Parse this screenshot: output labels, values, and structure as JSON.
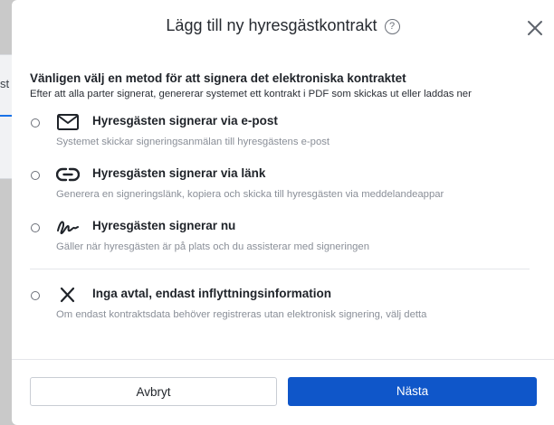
{
  "background": {
    "partial_tab_text": "st -"
  },
  "dialog": {
    "title": "Lägg till ny hyresgästkontrakt",
    "help_symbol": "?",
    "intro_title": "Vänligen välj en metod för att signera det elektroniska kontraktet",
    "intro_subtitle": "Efter att alla parter signerat, genererar systemet ett kontrakt i PDF som skickas ut eller laddas ner",
    "options": [
      {
        "icon": "envelope-icon",
        "label": "Hyresgästen signerar via e-post",
        "description": "Systemet skickar signeringsanmälan till hyresgästens e-post",
        "selected": false
      },
      {
        "icon": "link-icon",
        "label": "Hyresgästen signerar via länk",
        "description": "Generera en signeringslänk, kopiera och skicka till hyresgästen via meddelandeappar",
        "selected": false
      },
      {
        "icon": "signature-icon",
        "label": "Hyresgästen signerar nu",
        "description": "Gäller när hyresgästen är på plats och du assisterar med signeringen",
        "selected": false
      },
      {
        "icon": "x-icon",
        "label": "Inga avtal, endast inflyttningsinformation",
        "description": "Om endast kontraktsdata behöver registreras utan elektronisk signering, välj detta",
        "selected": false
      }
    ],
    "buttons": {
      "cancel": "Avbryt",
      "next": "Nästa"
    }
  },
  "colors": {
    "primary": "#0f56c9",
    "muted_text": "#8a8f98",
    "overlay": "#c9c9c9"
  }
}
